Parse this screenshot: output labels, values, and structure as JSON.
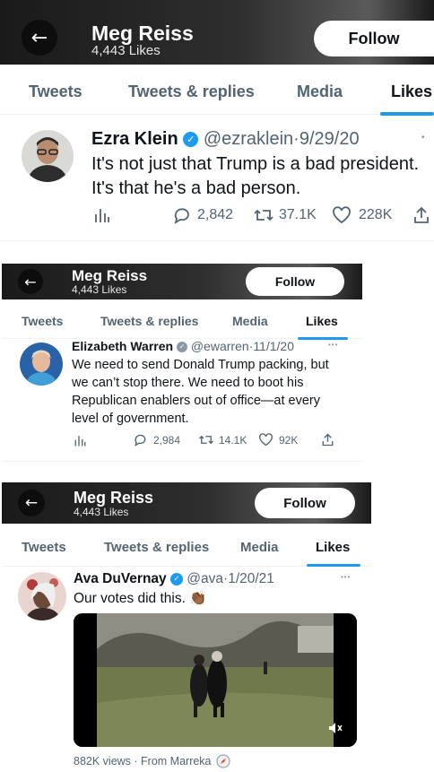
{
  "profile": {
    "name": "Meg Reiss",
    "likes": "4,443 Likes",
    "follow_label": "Follow"
  },
  "tabs": [
    "Tweets",
    "Tweets & replies",
    "Media",
    "Likes"
  ],
  "panel1": {
    "tabs_visible": [
      "Tweets",
      "Tweets & replies",
      "Media",
      "Likes"
    ],
    "tweet": {
      "name": "Ezra Klein",
      "handle": "@ezraklein",
      "date": "9/29/20",
      "line1": "It's not just that Trump is a bad president.",
      "line2": "It's that he's a bad person.",
      "replies": "2,842",
      "retweets": "37.1K",
      "likes": "228K"
    }
  },
  "panel2": {
    "tweet": {
      "name": "Elizabeth Warren",
      "handle": "@ewarren",
      "date": "11/1/20",
      "line1": "We need to send Donald Trump packing, but",
      "line2": "we can’t stop there. We need to boot his",
      "line3": "Republican enablers out of office—at every",
      "line4": "level of government.",
      "replies": "2,984",
      "retweets": "14.1K",
      "likes": "92K"
    }
  },
  "panel3": {
    "tweet": {
      "name": "Ava DuVernay",
      "handle": "@ava",
      "date": "1/20/21",
      "text": "Our votes did this.",
      "emoji": "👏🏾",
      "video_footer": "882K views · From Marreka"
    }
  },
  "separator_dot": "·",
  "more_dots": "•••",
  "icons": {
    "back": "arrow-left-icon",
    "verified": "verified-badge-icon",
    "analytics": "bar-chart-icon",
    "reply": "speech-bubble-icon",
    "retweet": "retweet-icon",
    "like": "heart-icon",
    "share": "share-upload-icon",
    "mute": "speaker-mute-icon",
    "compass": "compass-icon"
  },
  "colors": {
    "accent": "#1d9bf0",
    "text": "#0f1419",
    "muted": "#536471"
  }
}
